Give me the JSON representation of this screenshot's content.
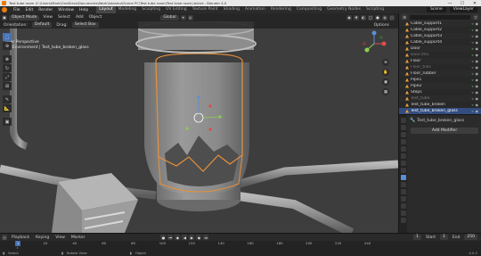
{
  "window": {
    "title": "Test tube room (C:\\Users\\Mark\\OneDrive\\Documents\\Work\\Istanbul\\Scene PC\\Test tube room\\Test tube room).blend - Blender 4.0",
    "minimize": "—",
    "maximize": "☐",
    "close": "✕"
  },
  "menubar": {
    "menus": [
      "File",
      "Edit",
      "Render",
      "Window",
      "Help"
    ],
    "workspaces": [
      "Layout",
      "Modeling",
      "Sculpting",
      "UV Editing",
      "Texture Paint",
      "Shading",
      "Animation",
      "Rendering",
      "Compositing",
      "Geometry Nodes",
      "Scripting"
    ],
    "active_workspace": "Layout",
    "scene": "Scene",
    "view_layer": "ViewLayer"
  },
  "viewport_header": {
    "mode": "Object Mode",
    "menus": [
      "View",
      "Select",
      "Add",
      "Object"
    ],
    "orientation": "Global",
    "drag": "Select Box",
    "pivot": "Default",
    "orientation_label": "Orientation:",
    "drag_label": "Drag:",
    "options": "Options"
  },
  "viewport": {
    "view_name": "User Perspective",
    "collection_info": "(0) Environment | Test_tube_broken_glass"
  },
  "toolbar": {
    "tools": [
      "select-box",
      "cursor",
      "move",
      "rotate",
      "scale",
      "transform",
      "annotate",
      "measure",
      "add-cube"
    ]
  },
  "outliner": {
    "items": [
      {
        "name": "Cable_support1",
        "hidden": false,
        "selected": false
      },
      {
        "name": "Cable_support2",
        "hidden": false,
        "selected": false
      },
      {
        "name": "Cable_support3",
        "hidden": false,
        "selected": false
      },
      {
        "name": "Cable_support4",
        "hidden": false,
        "selected": false
      },
      {
        "name": "Door",
        "hidden": false,
        "selected": false
      },
      {
        "name": "Door.001",
        "hidden": true,
        "selected": false
      },
      {
        "name": "Floor",
        "hidden": false,
        "selected": false
      },
      {
        "name": "Floor_tiles",
        "hidden": true,
        "selected": false
      },
      {
        "name": "Floor_rubber",
        "hidden": false,
        "selected": false
      },
      {
        "name": "Pipe1",
        "hidden": false,
        "selected": false
      },
      {
        "name": "Pipe2",
        "hidden": false,
        "selected": false
      },
      {
        "name": "Steps",
        "hidden": false,
        "selected": false
      },
      {
        "name": "Test_tube",
        "hidden": true,
        "selected": false
      },
      {
        "name": "Test_tube_broken",
        "hidden": false,
        "selected": false
      },
      {
        "name": "Test_tube_broken_glass",
        "hidden": false,
        "selected": true
      }
    ],
    "eye_glyph": "◉",
    "mat_glyph": "▿"
  },
  "properties": {
    "object_name": "Test_tube_broken_glass",
    "add_modifier": "Add Modifier"
  },
  "timeline": {
    "menus": [
      "Playback",
      "Keying",
      "View",
      "Marker"
    ],
    "current_frame": "1",
    "start_label": "Start",
    "start": "1",
    "end_label": "End",
    "end": "250",
    "ticks": [
      "20",
      "40",
      "60",
      "80",
      "100",
      "120",
      "140",
      "160",
      "180",
      "200",
      "220",
      "240"
    ],
    "playhead_value": "1"
  },
  "statusbar": {
    "items": [
      "Select",
      "Rotate View",
      "Object"
    ],
    "version": "4.0.2"
  },
  "colors": {
    "selection_outline": "#e8913a",
    "active_tab": "#4772b3",
    "viewport_bg": "#3d3d3d"
  }
}
